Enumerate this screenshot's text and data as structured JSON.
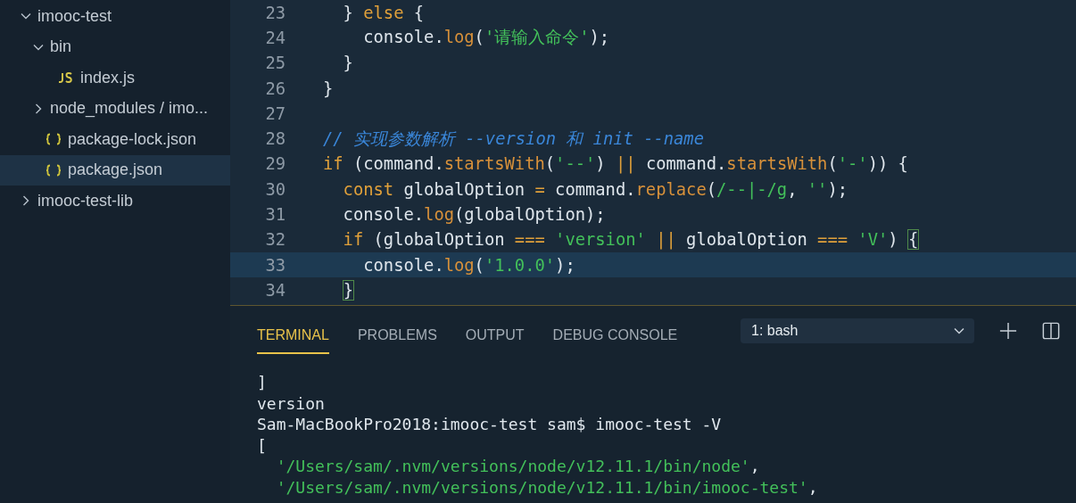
{
  "explorer": {
    "tree": [
      {
        "label": "imooc-test",
        "kind": "folder",
        "expanded": true,
        "selected": false,
        "children": [
          {
            "label": "bin",
            "kind": "folder",
            "expanded": true,
            "selected": false,
            "children": [
              {
                "label": "index.js",
                "kind": "js",
                "selected": false
              }
            ]
          },
          {
            "label": "node_modules / imo...",
            "kind": "folder",
            "expanded": false,
            "selected": false
          },
          {
            "label": "package-lock.json",
            "kind": "json",
            "selected": false
          },
          {
            "label": "package.json",
            "kind": "json",
            "selected": true
          }
        ]
      },
      {
        "label": "imooc-test-lib",
        "kind": "folder",
        "expanded": false,
        "selected": false
      }
    ]
  },
  "editor": {
    "lines": [
      {
        "number": "23",
        "current": false,
        "tokens": [
          {
            "kind": "plain",
            "text": "  } "
          },
          {
            "kind": "keyword",
            "text": "else"
          },
          {
            "kind": "plain",
            "text": " {"
          }
        ]
      },
      {
        "number": "24",
        "current": false,
        "tokens": [
          {
            "kind": "plain",
            "text": "    console."
          },
          {
            "kind": "func",
            "text": "log"
          },
          {
            "kind": "plain",
            "text": "("
          },
          {
            "kind": "string",
            "text": "'请输入命令'"
          },
          {
            "kind": "plain",
            "text": ");"
          }
        ]
      },
      {
        "number": "25",
        "current": false,
        "tokens": [
          {
            "kind": "plain",
            "text": "  }"
          }
        ]
      },
      {
        "number": "26",
        "current": false,
        "tokens": [
          {
            "kind": "plain",
            "text": "}"
          }
        ]
      },
      {
        "number": "27",
        "current": false
      },
      {
        "number": "28",
        "current": false,
        "tokens": [
          {
            "kind": "comment",
            "text": "// 实现参数解析 --version 和 init --name"
          }
        ]
      },
      {
        "number": "29",
        "current": false,
        "tokens": [
          {
            "kind": "keyword",
            "text": "if"
          },
          {
            "kind": "plain",
            "text": " (command."
          },
          {
            "kind": "func",
            "text": "startsWith"
          },
          {
            "kind": "plain",
            "text": "("
          },
          {
            "kind": "string",
            "text": "'--'"
          },
          {
            "kind": "plain",
            "text": ") "
          },
          {
            "kind": "keyword",
            "text": "||"
          },
          {
            "kind": "plain",
            "text": " command."
          },
          {
            "kind": "func",
            "text": "startsWith"
          },
          {
            "kind": "plain",
            "text": "("
          },
          {
            "kind": "string",
            "text": "'-'"
          },
          {
            "kind": "plain",
            "text": ")) {"
          }
        ]
      },
      {
        "number": "30",
        "current": false,
        "tokens": [
          {
            "kind": "keyword",
            "text": "  const"
          },
          {
            "kind": "plain",
            "text": " globalOption "
          },
          {
            "kind": "keyword",
            "text": "="
          },
          {
            "kind": "plain",
            "text": " command."
          },
          {
            "kind": "func",
            "text": "replace"
          },
          {
            "kind": "plain",
            "text": "("
          },
          {
            "kind": "string",
            "text": "/--|-/g"
          },
          {
            "kind": "plain",
            "text": ", "
          },
          {
            "kind": "string",
            "text": "''"
          },
          {
            "kind": "plain",
            "text": ");"
          }
        ]
      },
      {
        "number": "31",
        "current": false,
        "tokens": [
          {
            "kind": "plain",
            "text": "  console."
          },
          {
            "kind": "func",
            "text": "log"
          },
          {
            "kind": "plain",
            "text": "(globalOption);"
          }
        ]
      },
      {
        "number": "32",
        "current": false,
        "tokens": [
          {
            "kind": "keyword",
            "text": "  if"
          },
          {
            "kind": "plain",
            "text": " (globalOption "
          },
          {
            "kind": "keyword",
            "text": "=== "
          },
          {
            "kind": "string",
            "text": "'version' "
          },
          {
            "kind": "keyword",
            "text": "||"
          },
          {
            "kind": "plain",
            "text": " globalOption "
          },
          {
            "kind": "keyword",
            "text": "=== "
          },
          {
            "kind": "string",
            "text": "'V'"
          },
          {
            "kind": "plain",
            "text": ") "
          },
          {
            "kind": "match",
            "text": "{"
          }
        ]
      },
      {
        "number": "33",
        "current": true,
        "tokens": [
          {
            "kind": "plain",
            "text": "    console."
          },
          {
            "kind": "func",
            "text": "log"
          },
          {
            "kind": "plain",
            "text": "("
          },
          {
            "kind": "string",
            "text": "'1.0.0'"
          },
          {
            "kind": "plain",
            "text": ");"
          }
        ]
      },
      {
        "number": "34",
        "current": false,
        "tokens": [
          {
            "kind": "match",
            "text": "  }"
          }
        ]
      }
    ]
  },
  "panel": {
    "tabs": [
      {
        "label": "TERMINAL",
        "selected": true
      },
      {
        "label": "PROBLEMS",
        "selected": false
      },
      {
        "label": "OUTPUT",
        "selected": false
      },
      {
        "label": "DEBUG CONSOLE",
        "selected": false
      }
    ],
    "terminal_select": "1: bash",
    "terminal": [
      {
        "tokens": [
          {
            "kind": "plain",
            "text": "]"
          }
        ]
      },
      {
        "tokens": [
          {
            "kind": "plain",
            "text": "version"
          }
        ]
      },
      {
        "tokens": [
          {
            "kind": "plain",
            "text": "Sam-MacBookPro2018:imooc-test sam$ imooc-test -V"
          }
        ]
      },
      {
        "tokens": [
          {
            "kind": "plain",
            "text": "["
          }
        ]
      },
      {
        "tokens": [
          {
            "kind": "string",
            "text": "  '/Users/sam/.nvm/versions/node/v12.11.1/bin/node'"
          },
          {
            "kind": "plain",
            "text": ","
          }
        ]
      },
      {
        "tokens": [
          {
            "kind": "string",
            "text": "  '/Users/sam/.nvm/versions/node/v12.11.1/bin/imooc-test'"
          },
          {
            "kind": "plain",
            "text": ","
          }
        ]
      }
    ]
  }
}
